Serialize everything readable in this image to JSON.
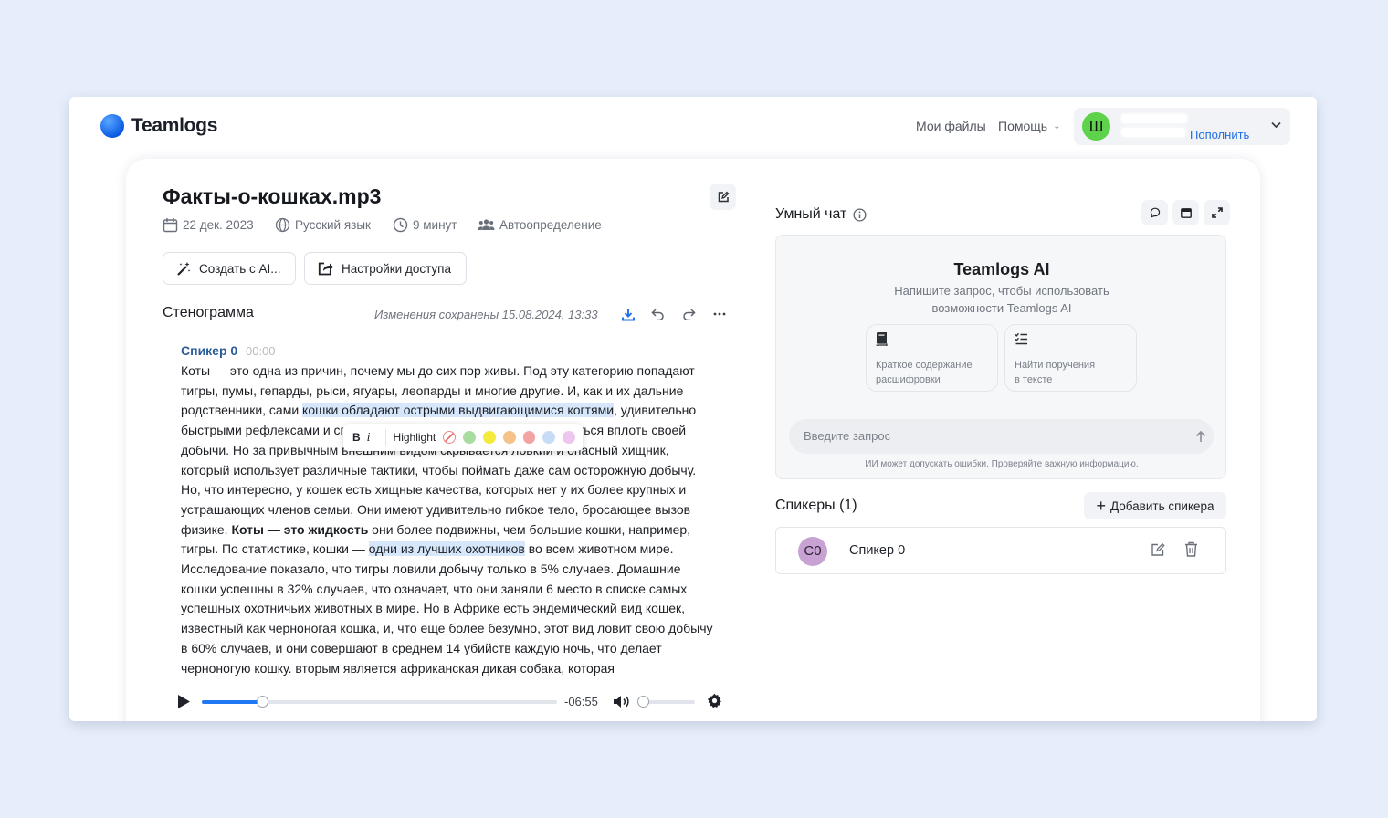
{
  "brand": {
    "name": "Teamlogs"
  },
  "nav": {
    "files": "Мои файлы",
    "help": "Помощь"
  },
  "account": {
    "avatar_letter": "Ш",
    "topup": "Пополнить"
  },
  "file": {
    "title": "Факты-о-кошках.mp3",
    "date": "22 дек. 2023",
    "language": "Русский язык",
    "duration": "9 минут",
    "speakers_mode": "Автоопределение"
  },
  "actions": {
    "create_ai": "Создать с AI...",
    "access_settings": "Настройки доступа"
  },
  "transcript": {
    "heading": "Стенограмма",
    "saved_status": "Изменения сохранены 15.08.2024, 13:33",
    "speaker": "Спикер 0",
    "speaker_time": "00:00",
    "segments": {
      "p1": "Коты — это одна из причин, почему мы до сих пор живы. Под эту категорию попадают тигры, пумы, гепарды, рыси, ягуары, леопарды и многие другие. И, как и их дальние родственники, сами ",
      "h1": "кошки обладают острыми выдвигающимися когтями",
      "p2": ", удивительно быстрыми рефлексами и способностью приспособиться и восхититься вплоть своей добычи. Но за привычным внешним видом скрывается ловкий и опасный хищник, который использует различные тактики, чтобы поймать даже сам осторожную добычу. Но, что интересно, у кошек есть хищные качества, которых нет у их более крупных и устрашающих членов семьи. Они имеют удивительно гибкое тело, бросающее вызов физике. ",
      "b1": "Коты — это жидкость",
      "p3": " они более подвижны, чем большие кошки, например, тигры. По статистике, кошки — ",
      "h2": "одни из лучших охотников",
      "p4": " во всем животном мире. Исследование показало, что тигры ловили добычу только в 5% случаев. Домашние кошки успешны в 32% случаев, что означает, что они заняли 6 место в списке самых успешных охотничьих животных в мире. Но в Африке есть эндемический вид кошек, известный как черноногая кошка, и, что еще более безумно, этот вид ловит свою добычу в 60% случаев, и они совершают в среднем 14 убийств каждую ночь, что делает черноногую кошку. вторым является африканская дикая собака, которая"
    }
  },
  "highlight_toolbar": {
    "bold": "B",
    "italic": "i",
    "label": "Highlight",
    "swatches": [
      "#a9dca0",
      "#f3ea3c",
      "#f5c38a",
      "#f4a3a3",
      "#c9dcf6",
      "#ecc6ef"
    ]
  },
  "player": {
    "remaining": "-06:55",
    "progress": 0.17,
    "volume": 0.05
  },
  "chat": {
    "title": "Умный чат",
    "ai_title": "Teamlogs AI",
    "ai_subtitle": "Напишите запрос, чтобы использовать возможности Teamlogs AI",
    "suggestions": [
      {
        "line1": "Краткое содержание",
        "line2": "расшифровки"
      },
      {
        "line1": "Найти поручения",
        "line2": "в тексте"
      }
    ],
    "input_placeholder": "Введите запрос",
    "disclaimer": "ИИ может допускать ошибки. Проверяйте важную информацию."
  },
  "speakers": {
    "title": "Спикеры (1)",
    "add_label": "Добавить спикера",
    "list": [
      {
        "initials": "С0",
        "name": "Спикер 0"
      }
    ]
  }
}
